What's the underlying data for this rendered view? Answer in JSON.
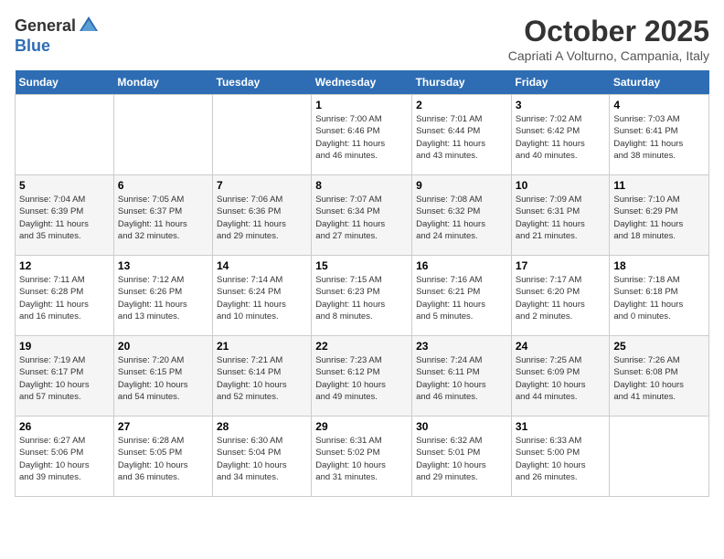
{
  "logo": {
    "general": "General",
    "blue": "Blue"
  },
  "title": "October 2025",
  "subtitle": "Capriati A Volturno, Campania, Italy",
  "days_of_week": [
    "Sunday",
    "Monday",
    "Tuesday",
    "Wednesday",
    "Thursday",
    "Friday",
    "Saturday"
  ],
  "weeks": [
    [
      {
        "day": "",
        "info": ""
      },
      {
        "day": "",
        "info": ""
      },
      {
        "day": "",
        "info": ""
      },
      {
        "day": "1",
        "info": "Sunrise: 7:00 AM\nSunset: 6:46 PM\nDaylight: 11 hours\nand 46 minutes."
      },
      {
        "day": "2",
        "info": "Sunrise: 7:01 AM\nSunset: 6:44 PM\nDaylight: 11 hours\nand 43 minutes."
      },
      {
        "day": "3",
        "info": "Sunrise: 7:02 AM\nSunset: 6:42 PM\nDaylight: 11 hours\nand 40 minutes."
      },
      {
        "day": "4",
        "info": "Sunrise: 7:03 AM\nSunset: 6:41 PM\nDaylight: 11 hours\nand 38 minutes."
      }
    ],
    [
      {
        "day": "5",
        "info": "Sunrise: 7:04 AM\nSunset: 6:39 PM\nDaylight: 11 hours\nand 35 minutes."
      },
      {
        "day": "6",
        "info": "Sunrise: 7:05 AM\nSunset: 6:37 PM\nDaylight: 11 hours\nand 32 minutes."
      },
      {
        "day": "7",
        "info": "Sunrise: 7:06 AM\nSunset: 6:36 PM\nDaylight: 11 hours\nand 29 minutes."
      },
      {
        "day": "8",
        "info": "Sunrise: 7:07 AM\nSunset: 6:34 PM\nDaylight: 11 hours\nand 27 minutes."
      },
      {
        "day": "9",
        "info": "Sunrise: 7:08 AM\nSunset: 6:32 PM\nDaylight: 11 hours\nand 24 minutes."
      },
      {
        "day": "10",
        "info": "Sunrise: 7:09 AM\nSunset: 6:31 PM\nDaylight: 11 hours\nand 21 minutes."
      },
      {
        "day": "11",
        "info": "Sunrise: 7:10 AM\nSunset: 6:29 PM\nDaylight: 11 hours\nand 18 minutes."
      }
    ],
    [
      {
        "day": "12",
        "info": "Sunrise: 7:11 AM\nSunset: 6:28 PM\nDaylight: 11 hours\nand 16 minutes."
      },
      {
        "day": "13",
        "info": "Sunrise: 7:12 AM\nSunset: 6:26 PM\nDaylight: 11 hours\nand 13 minutes."
      },
      {
        "day": "14",
        "info": "Sunrise: 7:14 AM\nSunset: 6:24 PM\nDaylight: 11 hours\nand 10 minutes."
      },
      {
        "day": "15",
        "info": "Sunrise: 7:15 AM\nSunset: 6:23 PM\nDaylight: 11 hours\nand 8 minutes."
      },
      {
        "day": "16",
        "info": "Sunrise: 7:16 AM\nSunset: 6:21 PM\nDaylight: 11 hours\nand 5 minutes."
      },
      {
        "day": "17",
        "info": "Sunrise: 7:17 AM\nSunset: 6:20 PM\nDaylight: 11 hours\nand 2 minutes."
      },
      {
        "day": "18",
        "info": "Sunrise: 7:18 AM\nSunset: 6:18 PM\nDaylight: 11 hours\nand 0 minutes."
      }
    ],
    [
      {
        "day": "19",
        "info": "Sunrise: 7:19 AM\nSunset: 6:17 PM\nDaylight: 10 hours\nand 57 minutes."
      },
      {
        "day": "20",
        "info": "Sunrise: 7:20 AM\nSunset: 6:15 PM\nDaylight: 10 hours\nand 54 minutes."
      },
      {
        "day": "21",
        "info": "Sunrise: 7:21 AM\nSunset: 6:14 PM\nDaylight: 10 hours\nand 52 minutes."
      },
      {
        "day": "22",
        "info": "Sunrise: 7:23 AM\nSunset: 6:12 PM\nDaylight: 10 hours\nand 49 minutes."
      },
      {
        "day": "23",
        "info": "Sunrise: 7:24 AM\nSunset: 6:11 PM\nDaylight: 10 hours\nand 46 minutes."
      },
      {
        "day": "24",
        "info": "Sunrise: 7:25 AM\nSunset: 6:09 PM\nDaylight: 10 hours\nand 44 minutes."
      },
      {
        "day": "25",
        "info": "Sunrise: 7:26 AM\nSunset: 6:08 PM\nDaylight: 10 hours\nand 41 minutes."
      }
    ],
    [
      {
        "day": "26",
        "info": "Sunrise: 6:27 AM\nSunset: 5:06 PM\nDaylight: 10 hours\nand 39 minutes."
      },
      {
        "day": "27",
        "info": "Sunrise: 6:28 AM\nSunset: 5:05 PM\nDaylight: 10 hours\nand 36 minutes."
      },
      {
        "day": "28",
        "info": "Sunrise: 6:30 AM\nSunset: 5:04 PM\nDaylight: 10 hours\nand 34 minutes."
      },
      {
        "day": "29",
        "info": "Sunrise: 6:31 AM\nSunset: 5:02 PM\nDaylight: 10 hours\nand 31 minutes."
      },
      {
        "day": "30",
        "info": "Sunrise: 6:32 AM\nSunset: 5:01 PM\nDaylight: 10 hours\nand 29 minutes."
      },
      {
        "day": "31",
        "info": "Sunrise: 6:33 AM\nSunset: 5:00 PM\nDaylight: 10 hours\nand 26 minutes."
      },
      {
        "day": "",
        "info": ""
      }
    ]
  ]
}
